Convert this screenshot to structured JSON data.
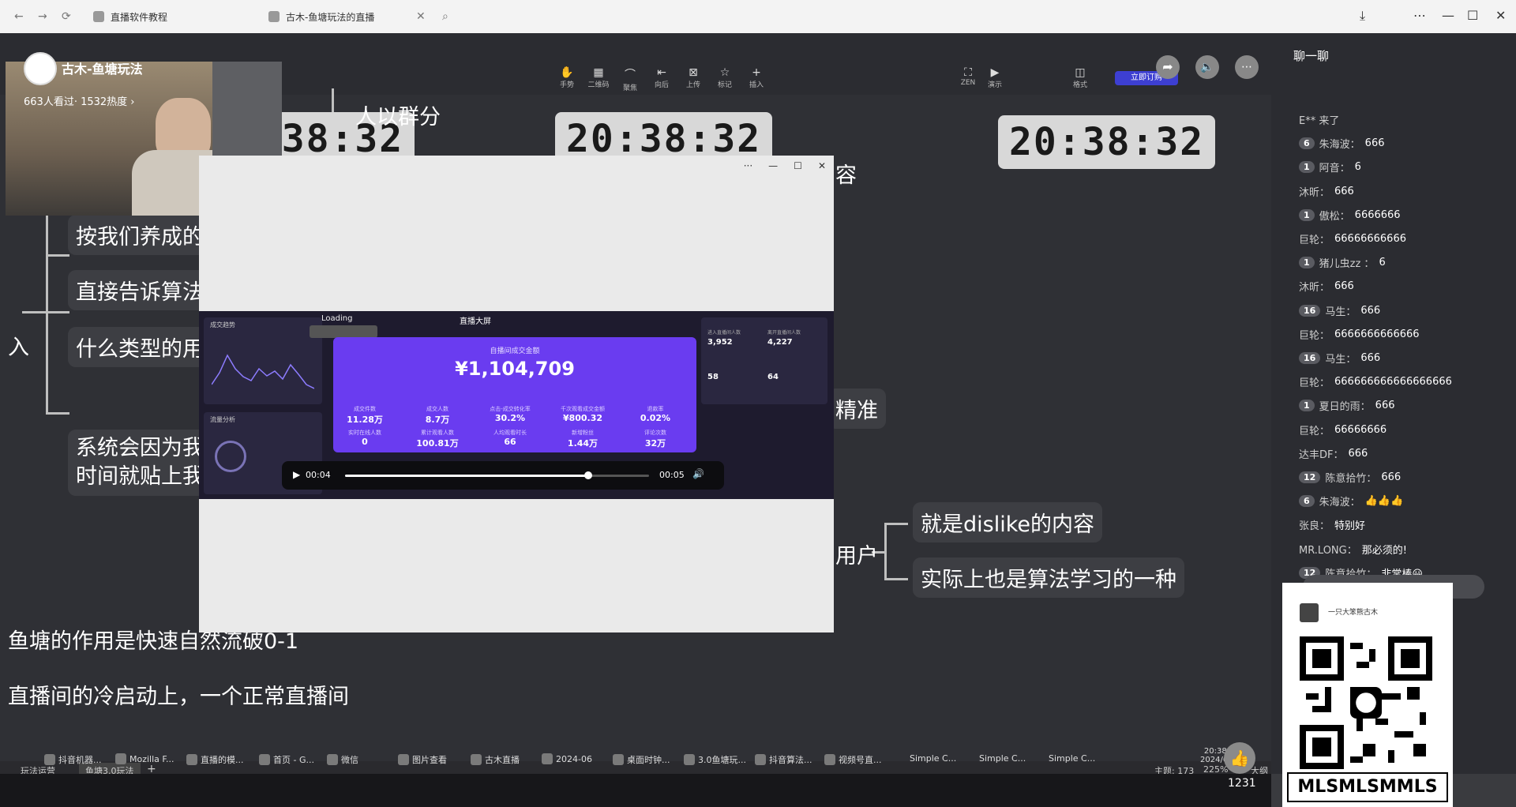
{
  "browser": {
    "tabs": [
      {
        "label": "直播软件教程"
      },
      {
        "label": "古木-鱼塘玩法的直播"
      }
    ],
    "controls": {
      "back": "←",
      "forward": "→",
      "reload": "⟳",
      "close_tab": "✕",
      "search": "⌕",
      "download": "⤓",
      "menu": "⋯",
      "minimize": "—",
      "maximize": "☐",
      "close": "✕"
    }
  },
  "streamer": {
    "name": "古木-鱼塘玩法",
    "stats": "663人看过· 1532热度 ›"
  },
  "ppt_toolbar": {
    "tools": [
      "手势",
      "二维码",
      "聚焦",
      "向后",
      "上传",
      "标记",
      "插入",
      "ZEN",
      "演示",
      "格式"
    ],
    "cta": "立即订购"
  },
  "mindmap": {
    "clocks": [
      "20:38:32",
      "20:38:32",
      "20:38:32"
    ],
    "nodes": {
      "n1": "人以群分",
      "n2": "按我们养成的",
      "n3": "直接告诉算法",
      "n4": "什么类型的用",
      "n5a": "系统会因为我",
      "n5b": "时间就贴上我",
      "n6": "容",
      "n7": "精准",
      "n8": "用户",
      "n9": "就是dislike的内容",
      "n10": "实际上也是算法学习的一种",
      "n11": "入",
      "n12": "鱼塘的作用是快速自然流破0-1",
      "n13": "直播间的冷启动上，一个正常直播间"
    }
  },
  "popup_player": {
    "controls": {
      "more": "···",
      "min": "—",
      "max": "☐",
      "close": "✕"
    },
    "loading": "Loading",
    "dashboard_title": "直播大屏",
    "card_title": "自播间成交金额",
    "amount": "¥1,104,709",
    "metrics": [
      {
        "label": "成交件数",
        "value": "11.28万"
      },
      {
        "label": "成交人数",
        "value": "8.7万"
      },
      {
        "label": "点击-成交转化率",
        "value": "30.2%"
      },
      {
        "label": "千次观看成交金额",
        "value": "¥800.32"
      },
      {
        "label": "退款率",
        "value": "0.02%"
      },
      {
        "label": "实时在线人数",
        "value": "0"
      },
      {
        "label": "累计观看人数",
        "value": "100.81万"
      },
      {
        "label": "人均观看时长",
        "value": "66"
      },
      {
        "label": "新增粉丝",
        "value": "1.44万"
      },
      {
        "label": "评论次数",
        "value": "32万"
      }
    ],
    "side_stats": [
      {
        "label": "进入直播间人数",
        "value": "3,952"
      },
      {
        "label": "离开直播间人数",
        "value": "4,227"
      },
      {
        "label": "",
        "value": "58"
      },
      {
        "label": "",
        "value": "64"
      }
    ],
    "panel_left": "成交趋势",
    "panel_left2": "流量分析",
    "time_current": "00:04",
    "time_total": "00:05",
    "progress": 0.8,
    "play_icon": "▶",
    "volume_icon": "🔊"
  },
  "chat": {
    "title": "聊一聊",
    "messages": [
      {
        "level": "",
        "user": "E** 来了",
        "text": ""
      },
      {
        "level": "6",
        "user": "朱海波：",
        "text": "666"
      },
      {
        "level": "1",
        "user": "阿音：",
        "text": "6"
      },
      {
        "level": "",
        "user": "沐昕：",
        "text": "666"
      },
      {
        "level": "1",
        "user": "傲松：",
        "text": "6666666"
      },
      {
        "level": "",
        "user": "巨轮：",
        "text": "66666666666"
      },
      {
        "level": "1",
        "user": "猪儿虫zz ：",
        "text": "6"
      },
      {
        "level": "",
        "user": "沐昕：",
        "text": "666"
      },
      {
        "level": "16",
        "user": "马生：",
        "text": "666"
      },
      {
        "level": "",
        "user": "巨轮：",
        "text": "6666666666666"
      },
      {
        "level": "16",
        "user": "马生：",
        "text": "666"
      },
      {
        "level": "",
        "user": "巨轮：",
        "text": "666666666666666666"
      },
      {
        "level": "1",
        "user": "夏日的雨：",
        "text": "666"
      },
      {
        "level": "",
        "user": "巨轮：",
        "text": "66666666"
      },
      {
        "level": "",
        "user": "达丰DF：",
        "text": "666"
      },
      {
        "level": "12",
        "user": "陈意拾竹：",
        "text": "666"
      },
      {
        "level": "6",
        "user": "朱海波：",
        "text": "👍👍👍"
      },
      {
        "level": "",
        "user": "张良：",
        "text": "特别好"
      },
      {
        "level": "",
        "user": "MR.LONG：",
        "text": "那必须的!"
      },
      {
        "level": "12",
        "user": "陈意拾竹：",
        "text": "非常棒😀"
      }
    ]
  },
  "qr_card": {
    "account": "一只大笨熊古木",
    "label": "MLSMLSMMLS"
  },
  "ppt_status": {
    "tab1": "玩法运营",
    "tab2": "鱼塘3.0玩法",
    "plus": "+",
    "theme": "主题: 173",
    "zoom": "225%",
    "size": "大纲"
  },
  "taskbar": {
    "items": [
      "抖音机器...",
      "Mozilla F...",
      "直播的模...",
      "首页 - G...",
      "微信",
      "图片查看",
      "古木直播",
      "2024-06",
      "桌面时钟...",
      "3.0鱼塘玩...",
      "抖音算法...",
      "视频号直...",
      "Simple C...",
      "Simple C...",
      "Simple C..."
    ],
    "clock_time": "20:38",
    "clock_date": "2024/6/"
  },
  "like": {
    "count": "1231",
    "icon": "👍"
  },
  "colors": {
    "popup_card": "#6a3cf0",
    "slide_bg": "#2f3035",
    "node_bg": "#3d3e43",
    "clock_bg": "#d8d8d8"
  }
}
